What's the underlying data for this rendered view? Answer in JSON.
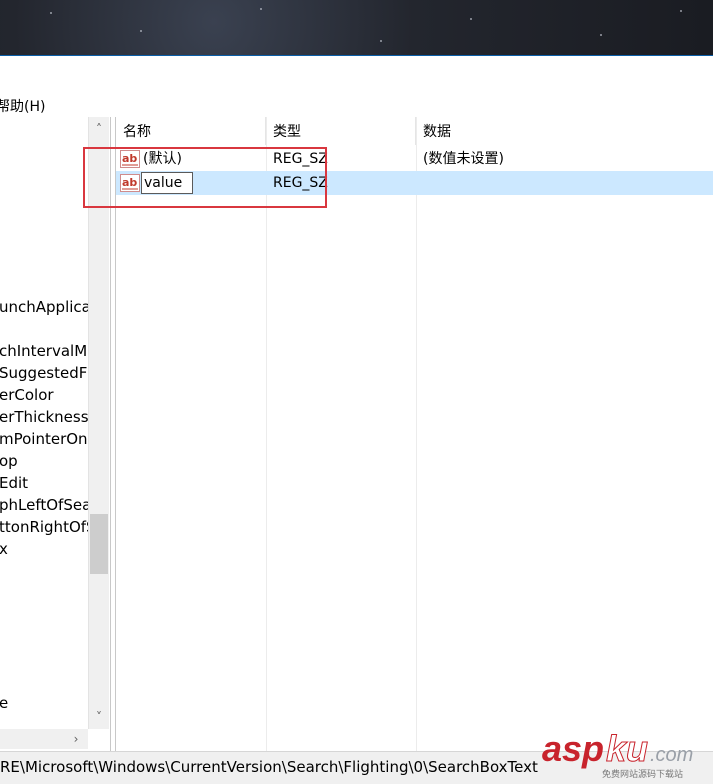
{
  "menu": {
    "help_label": "帮助(H)"
  },
  "tree": {
    "items": [
      "unchApplica",
      "chIntervalMi",
      "SuggestedF",
      "erColor",
      "erThickness",
      "mPointerOnH",
      "op",
      "Edit",
      "phLeftOfSea",
      "ttonRightOfS",
      "x",
      "e"
    ]
  },
  "list": {
    "columns": {
      "name": "名称",
      "type": "类型",
      "data": "数据"
    },
    "rows": [
      {
        "name": "(默认)",
        "type": "REG_SZ",
        "data": "(数值未设置)",
        "icon": "string-value-icon",
        "selected": false
      },
      {
        "name": "value",
        "type": "REG_SZ",
        "data": "",
        "icon": "string-value-icon",
        "selected": true,
        "editing": true
      }
    ]
  },
  "status": {
    "path": "RE\\Microsoft\\Windows\\CurrentVersion\\Search\\Flighting\\0\\SearchBoxText"
  },
  "watermark": {
    "brand": "aspku",
    "domain": ".com",
    "tagline": "免费网站源码下载站"
  },
  "colors": {
    "selection": "#cce8ff",
    "highlight": "#d9373f",
    "icon_red": "#c0392b"
  }
}
